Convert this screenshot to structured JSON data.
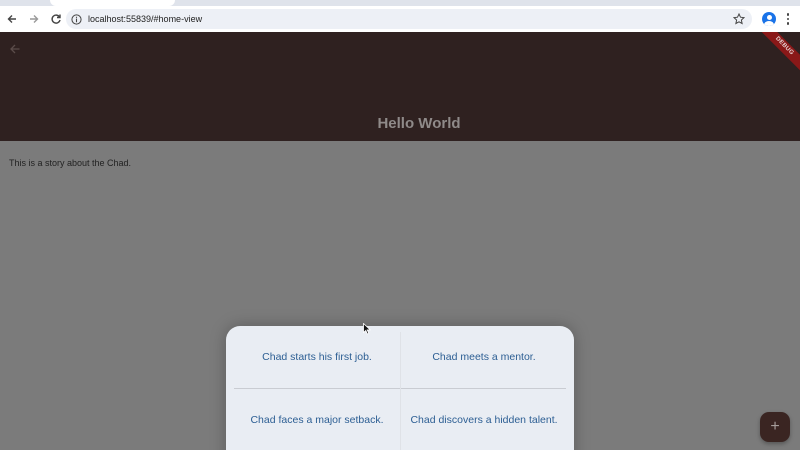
{
  "browser": {
    "url": "localhost:55839/#home-view",
    "back_icon": "back-arrow-icon",
    "forward_icon": "forward-arrow-icon",
    "reload_icon": "reload-icon"
  },
  "app": {
    "title": "Hello World",
    "debug_banner": "DEBUG",
    "body_text": "This is a story about the Chad.",
    "appbar_color": "#2f2120",
    "accent_text_color": "#2c5e93"
  },
  "sheet": {
    "options": [
      {
        "label": "Chad starts his first job."
      },
      {
        "label": "Chad meets a mentor."
      },
      {
        "label": "Chad faces a major setback."
      },
      {
        "label": "Chad discovers a hidden talent."
      }
    ]
  },
  "fab": {
    "label": "+",
    "icon": "add-icon"
  }
}
